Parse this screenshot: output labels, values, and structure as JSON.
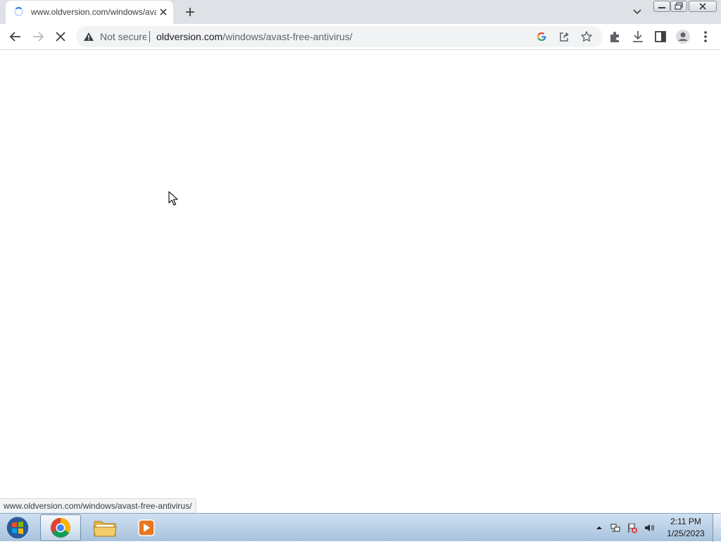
{
  "browser": {
    "tab": {
      "title": "www.oldversion.com/windows/avast-free-antivirus/",
      "state": "loading"
    },
    "omnibox": {
      "security_label": "Not secure",
      "url_host": "oldversion.com",
      "url_path": "/windows/avast-free-antivirus/"
    },
    "status_bubble": "www.oldversion.com/windows/avast-free-antivirus/",
    "icons": {
      "tab_strip": [
        "tab-spinner-icon",
        "close-icon",
        "plus-icon",
        "chevron-down-icon"
      ],
      "window_controls": [
        "minimize-icon",
        "restore-icon",
        "close-icon"
      ],
      "toolbar": [
        "back-arrow-icon",
        "forward-arrow-icon",
        "stop-icon",
        "warning-icon",
        "google-icon",
        "share-icon",
        "star-icon",
        "puzzle-icon",
        "download-icon",
        "side-panel-icon",
        "profile-icon",
        "kebab-menu-icon"
      ]
    },
    "colors": {
      "tab_strip": "#dee1e6",
      "omnibox": "#f1f3f4",
      "spinner": "#1a73e8"
    }
  },
  "taskbar": {
    "apps": [
      {
        "name": "Google Chrome",
        "icon": "chrome-icon",
        "active": true
      },
      {
        "name": "Windows Explorer",
        "icon": "folder-icon",
        "active": false
      },
      {
        "name": "Media Player",
        "icon": "media-player-icon",
        "active": false
      }
    ],
    "tray_icons": [
      "show-hidden-icons-chevron-icon",
      "network-icon",
      "action-center-flag-icon",
      "volume-icon"
    ],
    "clock": {
      "time": "2:11 PM",
      "date": "1/25/2023"
    }
  }
}
